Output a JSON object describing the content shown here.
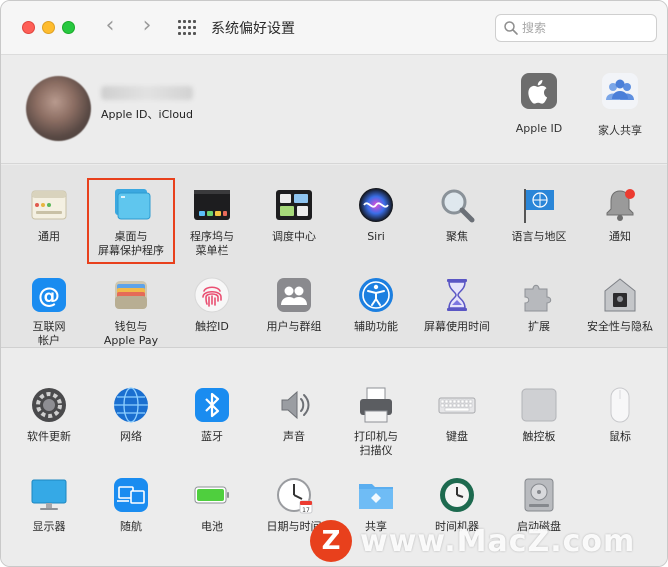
{
  "window": {
    "title": "系统偏好设置",
    "search_placeholder": "搜索"
  },
  "account": {
    "subtitle": "Apple ID、iCloud",
    "items": [
      {
        "label": "Apple ID",
        "icon": "apple-logo-icon"
      },
      {
        "label": "家人共享",
        "icon": "family-sharing-icon"
      }
    ]
  },
  "section1": {
    "row1": [
      {
        "label": "通用",
        "icon": "general-icon"
      },
      {
        "label": "桌面与\n屏幕保护程序",
        "icon": "desktop-screensaver-icon",
        "highlighted": true
      },
      {
        "label": "程序坞与\n菜单栏",
        "icon": "dock-menubar-icon"
      },
      {
        "label": "调度中心",
        "icon": "mission-control-icon"
      },
      {
        "label": "Siri",
        "icon": "siri-icon"
      },
      {
        "label": "聚焦",
        "icon": "spotlight-icon"
      },
      {
        "label": "语言与地区",
        "icon": "language-region-icon"
      },
      {
        "label": "通知",
        "icon": "notifications-icon"
      }
    ],
    "row2": [
      {
        "label": "互联网\n帐户",
        "icon": "internet-accounts-icon"
      },
      {
        "label": "钱包与\nApple Pay",
        "icon": "wallet-icon"
      },
      {
        "label": "触控ID",
        "icon": "touch-id-icon"
      },
      {
        "label": "用户与群组",
        "icon": "users-groups-icon"
      },
      {
        "label": "辅助功能",
        "icon": "accessibility-icon"
      },
      {
        "label": "屏幕使用时间",
        "icon": "screen-time-icon"
      },
      {
        "label": "扩展",
        "icon": "extensions-icon"
      },
      {
        "label": "安全性与隐私",
        "icon": "security-privacy-icon"
      }
    ]
  },
  "section2": {
    "row1": [
      {
        "label": "软件更新",
        "icon": "software-update-icon"
      },
      {
        "label": "网络",
        "icon": "network-icon"
      },
      {
        "label": "蓝牙",
        "icon": "bluetooth-icon"
      },
      {
        "label": "声音",
        "icon": "sound-icon"
      },
      {
        "label": "打印机与\n扫描仪",
        "icon": "printers-icon"
      },
      {
        "label": "键盘",
        "icon": "keyboard-icon"
      },
      {
        "label": "触控板",
        "icon": "trackpad-icon"
      },
      {
        "label": "鼠标",
        "icon": "mouse-icon"
      }
    ],
    "row2": [
      {
        "label": "显示器",
        "icon": "displays-icon"
      },
      {
        "label": "随航",
        "icon": "sidecar-icon"
      },
      {
        "label": "电池",
        "icon": "battery-icon"
      },
      {
        "label": "日期与时间",
        "icon": "date-time-icon"
      },
      {
        "label": "共享",
        "icon": "sharing-icon"
      },
      {
        "label": "时间机器",
        "icon": "time-machine-icon"
      },
      {
        "label": "启动磁盘",
        "icon": "startup-disk-icon"
      }
    ]
  },
  "watermark": {
    "logo_letter": "Z",
    "text": "www.MacZ.com"
  },
  "colors": {
    "highlight": "#e8401c",
    "close": "#fe5f57",
    "minimize": "#febc2e",
    "zoom": "#28c840"
  }
}
